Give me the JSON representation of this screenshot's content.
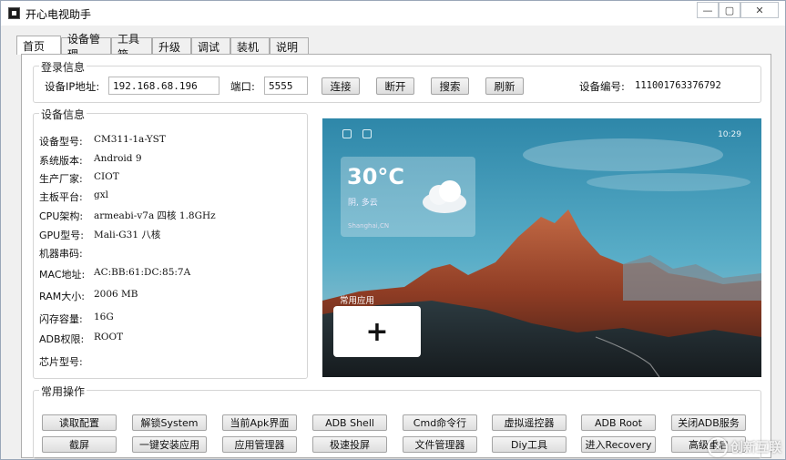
{
  "window": {
    "title": "开心电视助手",
    "minimize": "—",
    "maximize": "▢",
    "close": "✕"
  },
  "tabs": [
    {
      "label": "首页",
      "active": true
    },
    {
      "label": "设备管理"
    },
    {
      "label": "工具箱"
    },
    {
      "label": "升级"
    },
    {
      "label": "调试"
    },
    {
      "label": "装机"
    },
    {
      "label": "说明"
    }
  ],
  "login": {
    "legend": "登录信息",
    "ip_label": "设备IP地址:",
    "ip_value": "192.168.68.196",
    "port_label": "端口:",
    "port_value": "5555",
    "connect": "连接",
    "disconnect": "断开",
    "search": "搜索",
    "refresh": "刷新",
    "serial_label": "设备编号:",
    "serial_value": "111001763376792"
  },
  "device_info": {
    "legend": "设备信息",
    "rows": [
      {
        "key": "设备型号:",
        "value": "CM311-1a-YST"
      },
      {
        "key": "系统版本:",
        "value": "Android 9"
      },
      {
        "key": "生产厂家:",
        "value": "CIOT"
      },
      {
        "key": "主板平台:",
        "value": "gxl"
      },
      {
        "key": "CPU架构:",
        "value": "armeabi-v7a 四核 1.8GHz"
      },
      {
        "key": "GPU型号:",
        "value": "Mali-G31 八核"
      },
      {
        "key": "机器串码:",
        "value": ""
      },
      {
        "key": "MAC地址:",
        "value": "AC:BB:61:DC:85:7A"
      },
      {
        "key": "RAM大小:",
        "value": "2006 MB"
      },
      {
        "key": "闪存容量:",
        "value": "16G"
      },
      {
        "key": "ADB权限:",
        "value": "ROOT"
      },
      {
        "key": "芯片型号:",
        "value": ""
      }
    ]
  },
  "screenshot": {
    "clock": "10:29",
    "temperature": "30°C",
    "condition": "阴, 多云",
    "location": "Shanghai,CN",
    "common_apps_label": "常用应用",
    "add_symbol": "+"
  },
  "operations": {
    "legend": "常用操作",
    "row1": [
      "读取配置",
      "解锁System",
      "当前Apk界面",
      "ADB Shell",
      "Cmd命令行",
      "虚拟遥控器",
      "ADB  Root",
      "关闭ADB服务"
    ],
    "row2": [
      "截屏",
      "一键安装应用",
      "应用管理器",
      "极速投屏",
      "文件管理器",
      "Diy工具",
      "进入Recovery",
      "高级重启"
    ]
  },
  "watermark": {
    "text": "创新互联",
    "icon": "logo-icon"
  },
  "colors": {
    "sky_top": "#3d8fb0",
    "mountain_red": "#b9542f"
  }
}
